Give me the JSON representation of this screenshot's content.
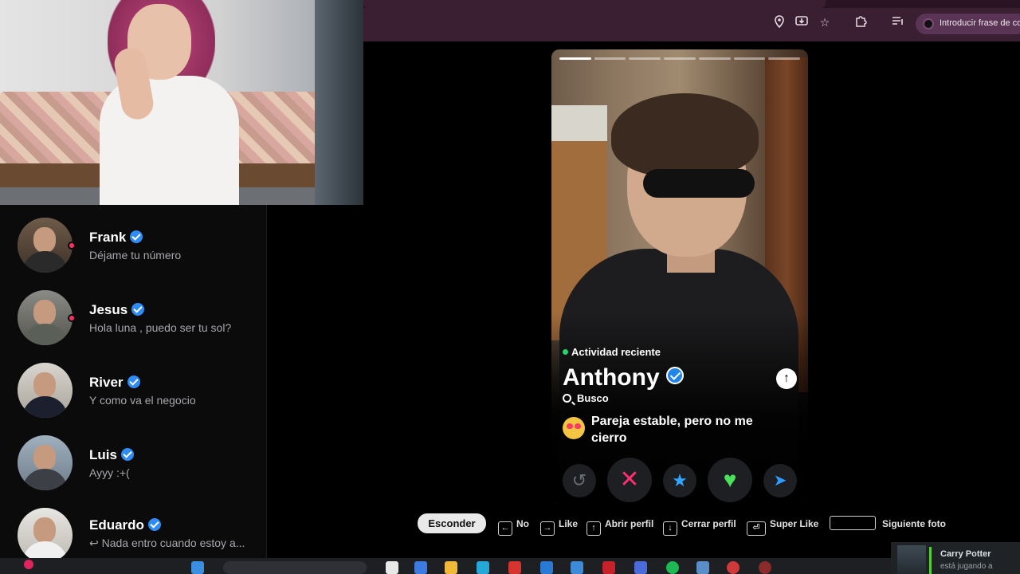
{
  "browser": {
    "profile_placeholder": "Introducir frase de co",
    "icons": [
      "location-pin-icon",
      "install-app-icon",
      "bookmark-star-icon",
      "extensions-icon",
      "media-controls-icon"
    ]
  },
  "conversations": [
    {
      "name": "Frank",
      "preview": "Déjame tu número",
      "verified": true,
      "unread": true
    },
    {
      "name": "Jesus",
      "preview": "Hola luna , puedo ser tu sol?",
      "verified": true,
      "unread": true
    },
    {
      "name": "River",
      "preview": "Y como va el negocio",
      "verified": true,
      "unread": false
    },
    {
      "name": "Luis",
      "preview": "Ayyy :+(",
      "verified": true,
      "unread": false
    },
    {
      "name": "Eduardo",
      "preview": "↩ Nada entro cuando estoy a...",
      "verified": true,
      "unread": false
    }
  ],
  "profile": {
    "activity": "Actividad reciente",
    "name": "Anthony",
    "verified": true,
    "seeking_label": "Busco",
    "goal": "Pareja estable, pero no me cierro",
    "photo_count": 7,
    "current_photo": 1
  },
  "actions": {
    "rewind": "↺",
    "nope": "✕",
    "super_like": "★",
    "like": "♥",
    "boost": "➤"
  },
  "hints": {
    "hide": "Esconder",
    "no": "No",
    "like": "Like",
    "open_profile": "Abrir perfil",
    "close_profile": "Cerrar perfil",
    "super_like": "Super Like",
    "next_photo": "Siguiente foto",
    "keys": {
      "left": "←",
      "right": "→",
      "up": "↑",
      "down": "↓",
      "enter": "⏎"
    }
  },
  "toast": {
    "name": "Carry Potter",
    "status": "está jugando a"
  },
  "colors": {
    "nope": "#ff2e6e",
    "like": "#49e35b",
    "super_like": "#2fa6ff",
    "verified": "#2f8cf5",
    "online": "#ff2e63",
    "activity": "#22d36e"
  }
}
